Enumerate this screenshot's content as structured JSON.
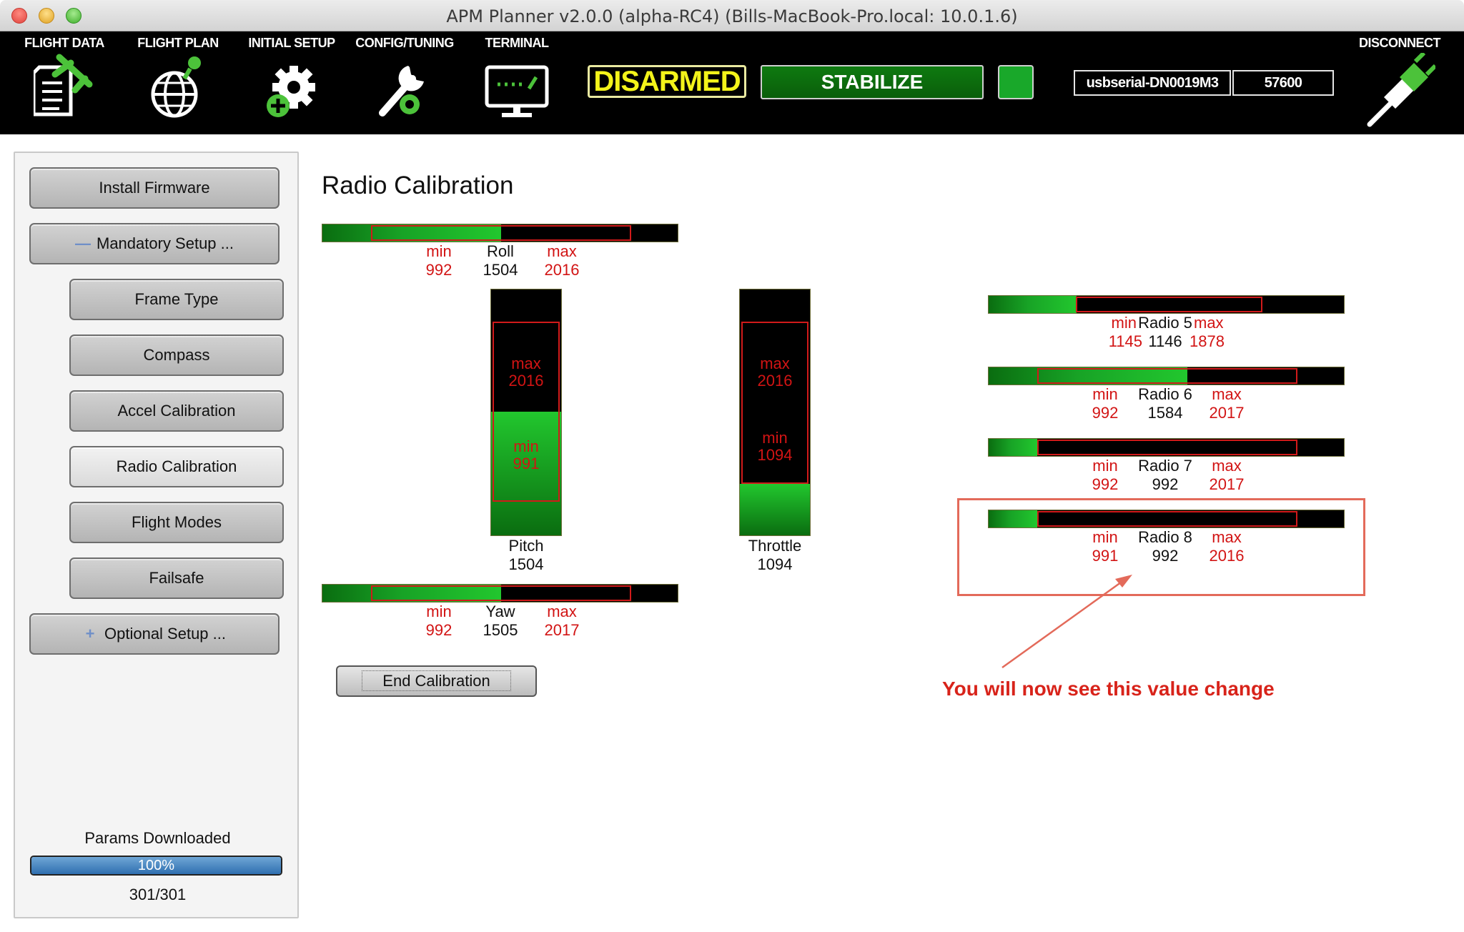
{
  "window": {
    "title": "APM Planner v2.0.0 (alpha-RC4) (Bills-MacBook-Pro.local: 10.0.1.6)"
  },
  "toolbar": {
    "items": [
      {
        "label": "FLIGHT DATA",
        "icon": "flight-data-icon"
      },
      {
        "label": "FLIGHT PLAN",
        "icon": "flight-plan-icon"
      },
      {
        "label": "INITIAL SETUP",
        "icon": "initial-setup-icon"
      },
      {
        "label": "CONFIG/TUNING",
        "icon": "config-tuning-icon"
      },
      {
        "label": "TERMINAL",
        "icon": "terminal-icon"
      }
    ],
    "arm_state": "DISARMED",
    "flight_mode": "STABILIZE",
    "port": "usbserial-DN0019M3",
    "baud": "57600",
    "disconnect": "DISCONNECT",
    "colors": {
      "arm_state": "#f3f31a",
      "flight_mode_bg": "#0e7a10",
      "status_light": "#19a82a"
    }
  },
  "sidebar": {
    "install_firmware": "Install Firmware",
    "mandatory_setup": {
      "icon": "minus-icon",
      "symbol": "—",
      "label": "Mandatory Setup ..."
    },
    "items": [
      {
        "label": "Frame Type"
      },
      {
        "label": "Compass"
      },
      {
        "label": "Accel Calibration"
      },
      {
        "label": "Radio Calibration",
        "active": true
      },
      {
        "label": "Flight Modes"
      },
      {
        "label": "Failsafe"
      }
    ],
    "optional_setup": {
      "icon": "plus-icon",
      "symbol": "+",
      "label": "Optional Setup ..."
    },
    "params": {
      "label": "Params Downloaded",
      "percent_text": "100%",
      "progress": 1.0,
      "count": "301/301"
    }
  },
  "main": {
    "title": "Radio Calibration",
    "range_min": 800,
    "range_max": 2200,
    "channels": {
      "roll": {
        "name": "Roll",
        "min_label": "min",
        "max_label": "max",
        "min": 992,
        "value": 1504,
        "max": 2016
      },
      "pitch": {
        "name": "Pitch",
        "min_label": "min",
        "max_label": "max",
        "min": 991,
        "value": 1504,
        "max": 2016
      },
      "throttle": {
        "name": "Throttle",
        "min_label": "min",
        "max_label": "max",
        "min": 1094,
        "value": 1094,
        "max": 2016
      },
      "yaw": {
        "name": "Yaw",
        "min_label": "min",
        "max_label": "max",
        "min": 992,
        "value": 1505,
        "max": 2017
      },
      "radio5": {
        "name": "Radio 5",
        "min_label": "min",
        "max_label": "max",
        "min": 1145,
        "value": 1146,
        "max": 1878
      },
      "radio6": {
        "name": "Radio 6",
        "min_label": "min",
        "max_label": "max",
        "min": 992,
        "value": 1584,
        "max": 2017
      },
      "radio7": {
        "name": "Radio 7",
        "min_label": "min",
        "max_label": "max",
        "min": 992,
        "value": 992,
        "max": 2017
      },
      "radio8": {
        "name": "Radio 8",
        "min_label": "min",
        "max_label": "max",
        "min": 991,
        "value": 992,
        "max": 2016
      }
    },
    "end_calibration": "End Calibration",
    "annotation": "You will now see this value change",
    "colors": {
      "range_outline": "#d11a1a",
      "annotation": "#d8231a",
      "bar_fill": "#18a326"
    }
  }
}
